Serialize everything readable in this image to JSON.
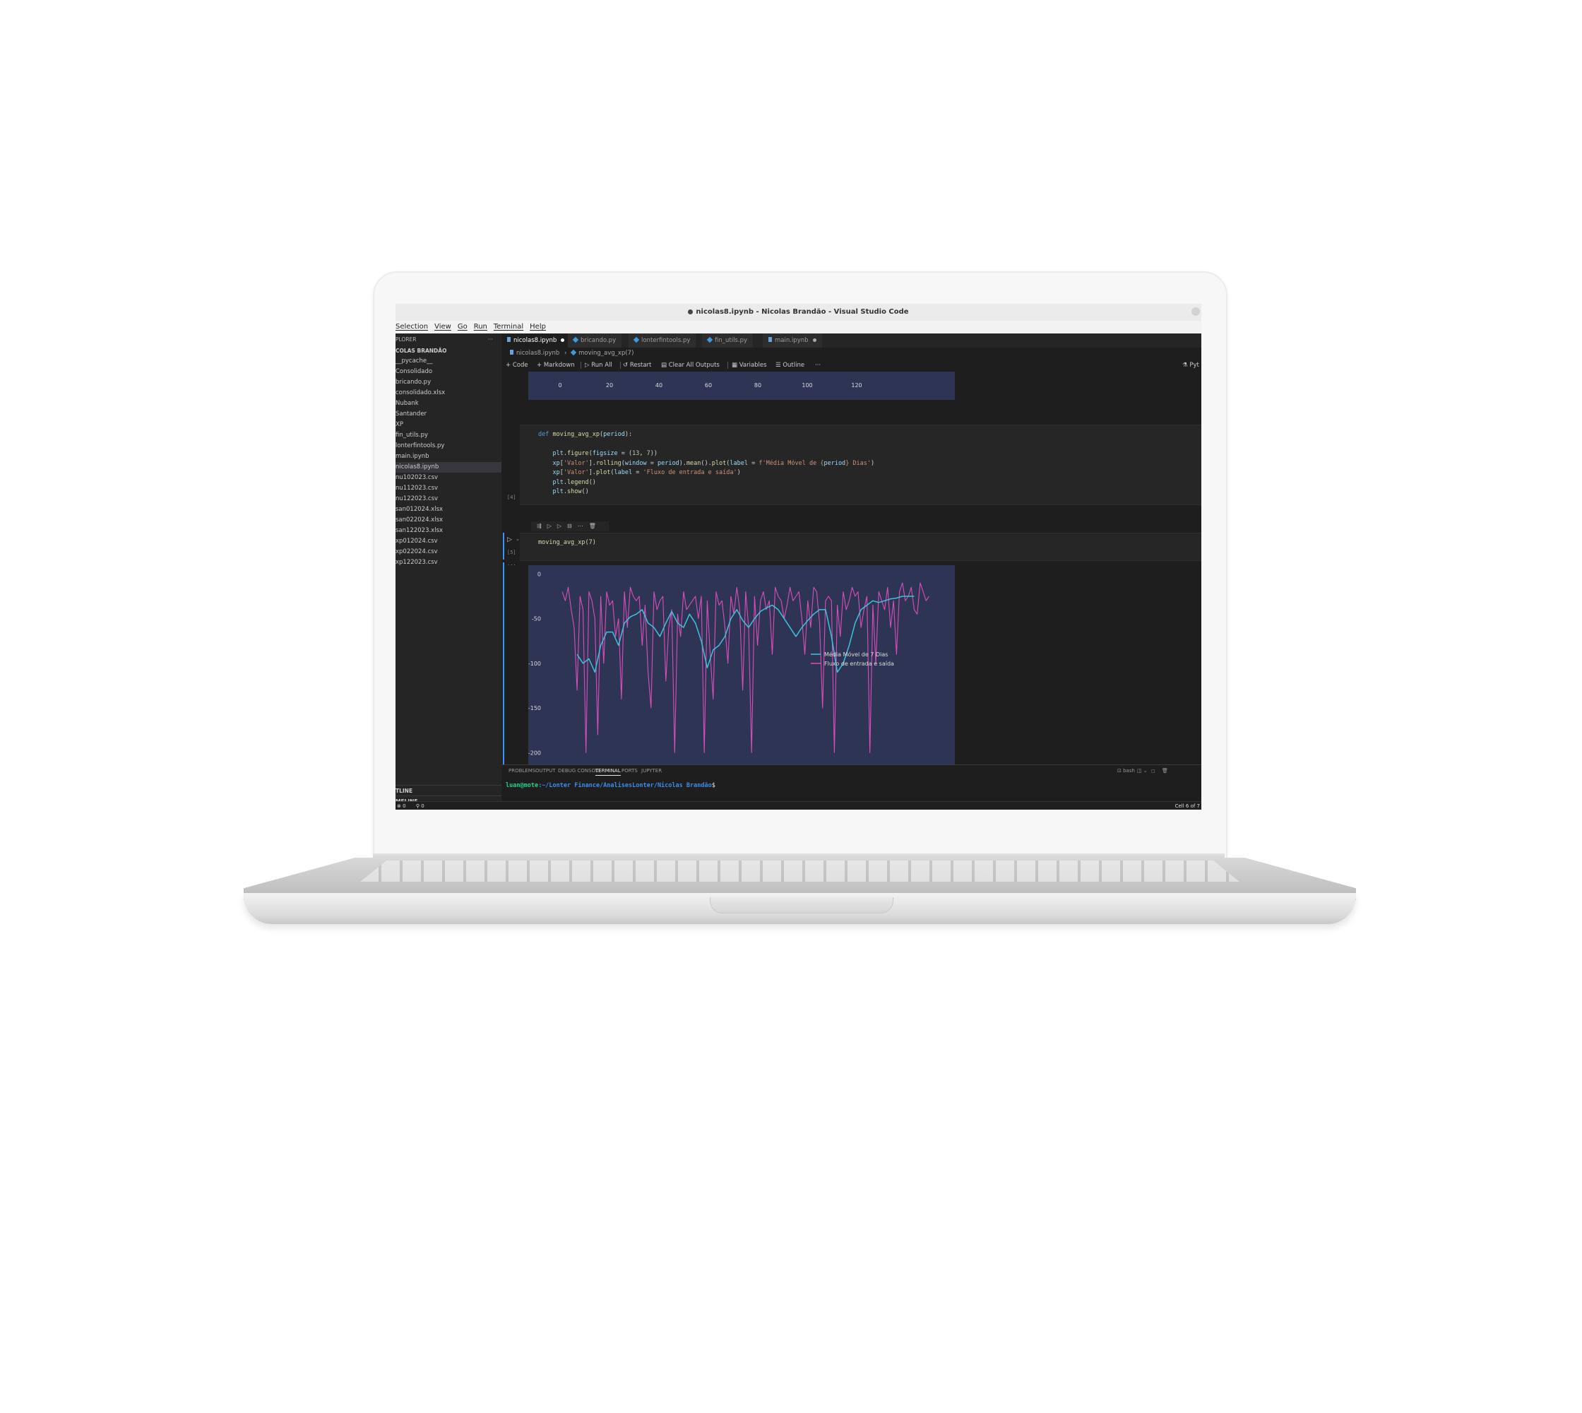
{
  "window": {
    "title": "nicolas8.ipynb - Nicolas Brandão - Visual Studio Code"
  },
  "menu": [
    "Selection",
    "View",
    "Go",
    "Run",
    "Terminal",
    "Help"
  ],
  "sidebar": {
    "header": "PLORER",
    "more": "···",
    "root": "COLAS BRANDÃO",
    "items": [
      {
        "label": "__pycache__"
      },
      {
        "label": "Consolidado"
      },
      {
        "label": "bricando.py"
      },
      {
        "label": "consolidado.xlsx"
      },
      {
        "label": "Nubank"
      },
      {
        "label": "Santander"
      },
      {
        "label": "XP"
      },
      {
        "label": "fin_utils.py"
      },
      {
        "label": "lonterfintools.py"
      },
      {
        "label": "main.ipynb"
      },
      {
        "label": "nicolas8.ipynb",
        "active": true
      },
      {
        "label": "nu102023.csv"
      },
      {
        "label": "nu112023.csv"
      },
      {
        "label": "nu122023.csv"
      },
      {
        "label": "san012024.xlsx"
      },
      {
        "label": "san022024.xlsx"
      },
      {
        "label": "san122023.xlsx"
      },
      {
        "label": "xp012024.csv"
      },
      {
        "label": "xp022024.csv"
      },
      {
        "label": "xp122023.csv"
      }
    ],
    "outline": "TLINE",
    "timeline": "MELINE"
  },
  "tabs": [
    {
      "label": "nicolas8.ipynb",
      "active": true,
      "modified": true
    },
    {
      "label": "bricando.py"
    },
    {
      "label": "lonterfintools.py"
    },
    {
      "label": "fin_utils.py"
    },
    {
      "label": "main.ipynb",
      "modified": true
    }
  ],
  "breadcrumb": {
    "file": "nicolas8.ipynb",
    "sep": "›",
    "symbol": "moving_avg_xp(7)"
  },
  "toolbar": {
    "code": "Code",
    "markdown": "Markdown",
    "run_all": "Run All",
    "restart": "Restart",
    "clear": "Clear All Outputs",
    "variables": "Variables",
    "outline": "Outline",
    "more": "···",
    "kernel": "Pyt"
  },
  "prev_plot": {
    "x_ticks": [
      "0",
      "20",
      "40",
      "60",
      "80",
      "100",
      "120"
    ]
  },
  "cells": {
    "def_cell_number": "[4]",
    "code_lines": [
      "def moving_avg_xp(period):",
      "",
      "    plt.figure(figsize = (13, 7))",
      "    xp['Valor'].rolling(window = period).mean().plot(label = f'Média Móvel de {period} Dias')",
      "    xp['Valor'].plot(label = 'Fluxo de entrada e saída')",
      "    plt.legend()",
      "    plt.show()"
    ],
    "call_cell_number": "[5]",
    "call_code": "moving_avg_xp(7)",
    "output_marker": "···"
  },
  "chart_data": {
    "type": "line",
    "title": "",
    "xlabel": "",
    "ylabel": "",
    "xlim": [
      0,
      128
    ],
    "ylim": [
      -210,
      5
    ],
    "y_ticks": [
      0,
      -50,
      -100,
      -150,
      -200
    ],
    "legend": "right",
    "series": [
      {
        "name": "Média Móvel de 7 Dias",
        "color": "#3ec3dc",
        "x": [
          6,
          8,
          10,
          12,
          14,
          16,
          18,
          20,
          22,
          24,
          26,
          28,
          30,
          32,
          34,
          36,
          38,
          40,
          42,
          44,
          46,
          48,
          50,
          52,
          54,
          56,
          58,
          60,
          62,
          64,
          66,
          68,
          70,
          72,
          74,
          76,
          78,
          80,
          82,
          84,
          86,
          88,
          90,
          92,
          94,
          96,
          98,
          100,
          102,
          104,
          106,
          108,
          110,
          112,
          114,
          116,
          118,
          120
        ],
        "y": [
          -90,
          -100,
          -95,
          -110,
          -80,
          -65,
          -65,
          -80,
          -55,
          -48,
          -45,
          -40,
          -55,
          -60,
          -70,
          -55,
          -42,
          -55,
          -60,
          -45,
          -55,
          -75,
          -105,
          -85,
          -80,
          -70,
          -50,
          -40,
          -52,
          -60,
          -50,
          -42,
          -38,
          -35,
          -40,
          -50,
          -60,
          -70,
          -60,
          -52,
          -45,
          -40,
          -40,
          -70,
          -110,
          -100,
          -80,
          -55,
          -40,
          -35,
          -30,
          -32,
          -30,
          -28,
          -27,
          -25,
          -25,
          -25
        ]
      },
      {
        "name": "Fluxo de entrada e saída",
        "color": "#d84fb8",
        "x": [
          1,
          2,
          3,
          4,
          5,
          6,
          7,
          8,
          9,
          10,
          11,
          12,
          13,
          14,
          15,
          16,
          17,
          18,
          19,
          20,
          21,
          22,
          23,
          24,
          25,
          26,
          27,
          28,
          29,
          30,
          31,
          32,
          33,
          34,
          35,
          36,
          37,
          38,
          39,
          40,
          41,
          42,
          43,
          44,
          45,
          46,
          47,
          48,
          49,
          50,
          51,
          52,
          53,
          54,
          55,
          56,
          57,
          58,
          59,
          60,
          61,
          62,
          63,
          64,
          65,
          66,
          67,
          68,
          69,
          70,
          71,
          72,
          73,
          74,
          75,
          76,
          77,
          78,
          79,
          80,
          81,
          82,
          83,
          84,
          85,
          86,
          87,
          88,
          89,
          90,
          91,
          92,
          93,
          94,
          95,
          96,
          97,
          98,
          99,
          100,
          101,
          102,
          103,
          104,
          105,
          106,
          107,
          108,
          109,
          110,
          111,
          112,
          113,
          114,
          115,
          116,
          117,
          118,
          119,
          120,
          121,
          122,
          123,
          124,
          125
        ],
        "y": [
          -20,
          -30,
          -15,
          -40,
          -60,
          -130,
          -25,
          -40,
          -200,
          -20,
          -30,
          -50,
          -180,
          -25,
          -100,
          -20,
          -35,
          -30,
          -70,
          -50,
          -140,
          -20,
          -60,
          -15,
          -25,
          -30,
          -25,
          -80,
          -35,
          -110,
          -150,
          -20,
          -40,
          -30,
          -25,
          -120,
          -60,
          -40,
          -200,
          -45,
          -70,
          -20,
          -40,
          -35,
          -30,
          -25,
          -50,
          -25,
          -200,
          -30,
          -90,
          -140,
          -20,
          -35,
          -30,
          -60,
          -100,
          -25,
          -45,
          -15,
          -40,
          -130,
          -20,
          -60,
          -200,
          -25,
          -80,
          -30,
          -20,
          -40,
          -30,
          -90,
          -15,
          -25,
          -30,
          -50,
          -35,
          -15,
          -30,
          -25,
          -20,
          -50,
          -90,
          -30,
          -60,
          -15,
          -20,
          -55,
          -150,
          -30,
          -25,
          -30,
          -200,
          -35,
          -70,
          -20,
          -40,
          -30,
          -15,
          -25,
          -20,
          -60,
          -40,
          -25,
          -200,
          -35,
          -100,
          -20,
          -30,
          -40,
          -15,
          -60,
          -30,
          -90,
          -20,
          -10,
          -30,
          -25,
          -15,
          -40,
          -45,
          -10,
          -20,
          -30,
          -25
        ]
      }
    ]
  },
  "panel": {
    "tabs": [
      "PROBLEMS",
      "OUTPUT",
      "DEBUG CONSOLE",
      "TERMINAL",
      "PORTS",
      "JUPYTER"
    ],
    "active": "TERMINAL",
    "shell": "bash",
    "prompt_user": "luan@mote",
    "prompt_path": ":~/Lonter Finance/AnalisesLonter/Nicolas Brandão",
    "prompt_end": "$"
  },
  "status": {
    "errors": "0",
    "warnings": "0",
    "cell": "Cell 6 of 7"
  }
}
